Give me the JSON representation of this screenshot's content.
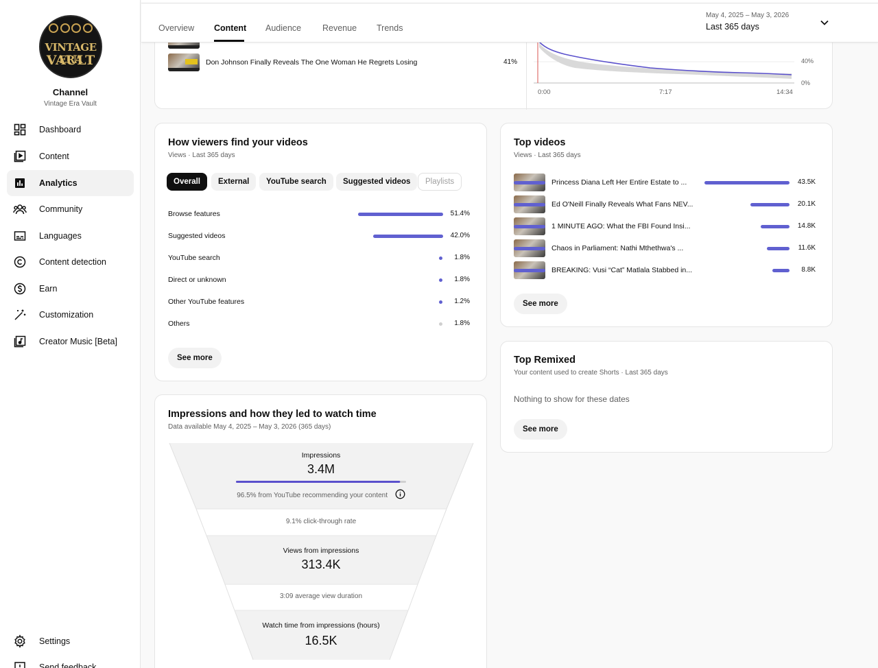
{
  "channel": {
    "logo_line1": "VINTAGE ERA",
    "logo_line2": "VAULT",
    "title": "Channel",
    "name": "Vintage Era Vault"
  },
  "sidebar": {
    "items": [
      {
        "label": "Dashboard",
        "icon": "dashboard-icon"
      },
      {
        "label": "Content",
        "icon": "content-icon"
      },
      {
        "label": "Analytics",
        "icon": "analytics-icon"
      },
      {
        "label": "Community",
        "icon": "community-icon"
      },
      {
        "label": "Languages",
        "icon": "subtitles-icon"
      },
      {
        "label": "Content detection",
        "icon": "copyright-icon"
      },
      {
        "label": "Earn",
        "icon": "dollar-icon"
      },
      {
        "label": "Customization",
        "icon": "magic-wand-icon"
      },
      {
        "label": "Creator Music [Beta]",
        "icon": "music-icon"
      }
    ],
    "settings": "Settings",
    "feedback": "Send feedback"
  },
  "tabs": [
    "Overview",
    "Content",
    "Audience",
    "Revenue",
    "Trends"
  ],
  "date": {
    "range": "May 4, 2025 – May 3, 2026",
    "label": "Last 365 days"
  },
  "top_card": {
    "video_title": "Don Johnson Finally Reveals The One Woman He Regrets Losing",
    "video_pct": "41%",
    "chart_data": {
      "type": "line",
      "x_ticks": [
        "0:00",
        "7:17",
        "14:34"
      ],
      "y_ticks": [
        "40%",
        "0%"
      ]
    }
  },
  "traffic": {
    "title": "How viewers find your videos",
    "subtitle": "Views · Last 365 days",
    "chips": [
      "Overall",
      "External",
      "YouTube search",
      "Suggested videos",
      "Playlists"
    ],
    "rows": [
      {
        "name": "Browse features",
        "pct": "51.4%",
        "value": 51.4
      },
      {
        "name": "Suggested videos",
        "pct": "42.0%",
        "value": 42.0
      },
      {
        "name": "YouTube search",
        "pct": "1.8%",
        "value": 1.8
      },
      {
        "name": "Direct or unknown",
        "pct": "1.8%",
        "value": 1.8
      },
      {
        "name": "Other YouTube features",
        "pct": "1.2%",
        "value": 1.2
      },
      {
        "name": "Others",
        "pct": "1.8%",
        "value": 1.8
      }
    ],
    "see_more": "See more"
  },
  "top_videos": {
    "title": "Top videos",
    "subtitle": "Views · Last 365 days",
    "rows": [
      {
        "title": "Princess Diana Left Her Entire Estate to ...",
        "views": "43.5K",
        "value": 43.5
      },
      {
        "title": "Ed O'Neill Finally Reveals What Fans NEV...",
        "views": "20.1K",
        "value": 20.1
      },
      {
        "title": "1 MINUTE AGO: What the FBI Found Insi...",
        "views": "14.8K",
        "value": 14.8
      },
      {
        "title": "Chaos in Parliament: Nathi Mthethwa's ...",
        "views": "11.6K",
        "value": 11.6
      },
      {
        "title": "BREAKING: Vusi “Cat” Matlala Stabbed in...",
        "views": "8.8K",
        "value": 8.8
      }
    ],
    "see_more": "See more"
  },
  "remixed": {
    "title": "Top Remixed",
    "subtitle": "Your content used to create Shorts · Last 365 days",
    "empty": "Nothing to show for these dates",
    "see_more": "See more"
  },
  "impressions": {
    "title": "Impressions and how they led to watch time",
    "subtitle": "Data available May 4, 2025 – May 3, 2026 (365 days)",
    "impressions_label": "Impressions",
    "impressions_value": "3.4M",
    "recommend_text": "96.5% from YouTube recommending your content",
    "recommend_fraction": 0.965,
    "ctr": "9.1% click-through rate",
    "views_label": "Views from impressions",
    "views_value": "313.4K",
    "avg_duration": "3:09 average view duration",
    "watch_label": "Watch time from impressions (hours)",
    "watch_value": "16.5K"
  },
  "colors": {
    "accent": "#6060d0",
    "text": "#0f0f0f",
    "muted": "#606060"
  }
}
